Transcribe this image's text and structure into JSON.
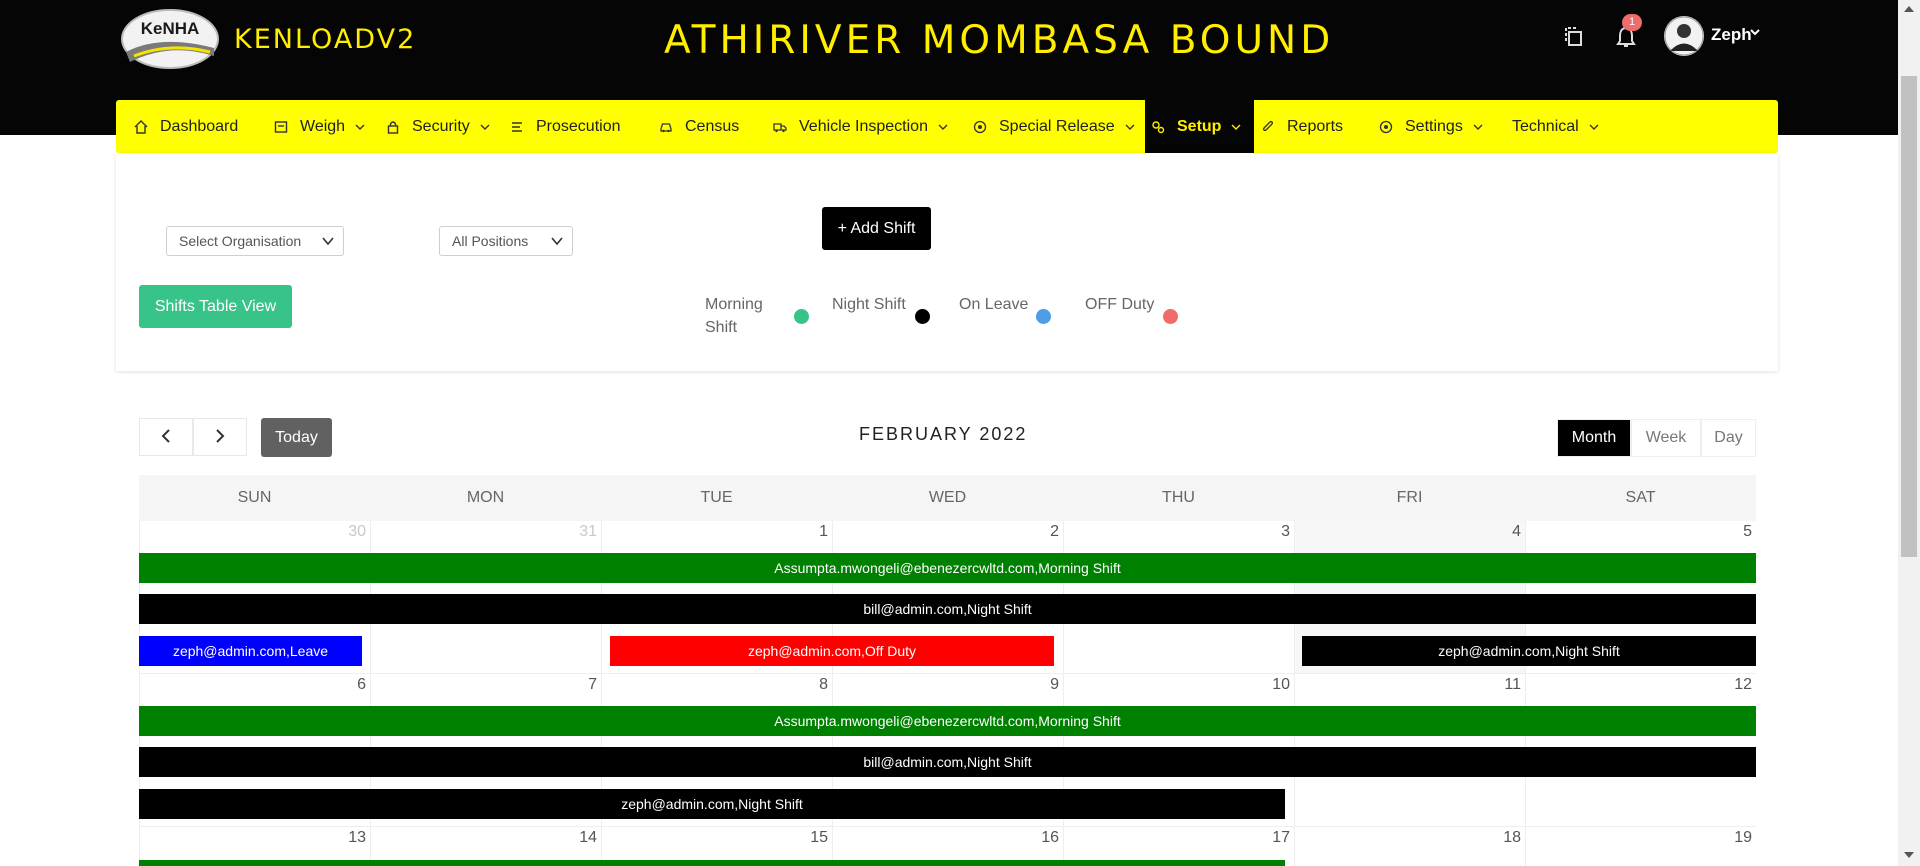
{
  "header": {
    "logo_text": "KeNHA",
    "brand": "KENLOADV2",
    "page_heading": "ATHIRIVER MOMBASA BOUND",
    "notification_count": "1",
    "user_name": "Zeph"
  },
  "nav": {
    "items": [
      {
        "label": "Dashboard",
        "icon": "home-icon"
      },
      {
        "label": "Weigh",
        "icon": "scale-icon"
      },
      {
        "label": "Security",
        "icon": "lock-icon"
      },
      {
        "label": "Prosecution",
        "icon": "list-icon"
      },
      {
        "label": "Census",
        "icon": "car-icon"
      },
      {
        "label": "Vehicle Inspection",
        "icon": "truck-icon"
      },
      {
        "label": "Special Release",
        "icon": "target-icon"
      },
      {
        "label": "Setup",
        "icon": "cogs-icon",
        "active": true
      },
      {
        "label": "Reports",
        "icon": "paperclip-icon"
      },
      {
        "label": "Settings",
        "icon": "target-icon"
      },
      {
        "label": "Technical",
        "icon": ""
      }
    ]
  },
  "filters": {
    "organisation": "Select Organisation",
    "positions": "All Positions",
    "add_shift": "+ Add Shift",
    "table_view": "Shifts Table View"
  },
  "legend": {
    "morning_line1": "Morning",
    "morning_line2": "Shift",
    "night": "Night Shift",
    "leave": "On Leave",
    "off": "OFF Duty",
    "colors": {
      "morning": "#38c389",
      "night": "#000000",
      "leave": "#4d9de8",
      "off": "#ef6c6c"
    }
  },
  "calendar": {
    "title": "FEBRUARY 2022",
    "today_label": "Today",
    "views": [
      "Month",
      "Week",
      "Day"
    ],
    "days_of_week": [
      "SUN",
      "MON",
      "TUE",
      "WED",
      "THU",
      "FRI",
      "SAT"
    ],
    "weeks": [
      {
        "dates": [
          "30",
          "31",
          "1",
          "2",
          "3",
          "4",
          "5"
        ],
        "events": [
          {
            "text": "Assumpta.mwongeli@ebenezercwltd.com,Morning Shift",
            "color": "green"
          },
          {
            "text": "bill@admin.com,Night Shift",
            "color": "black"
          },
          {
            "text": "zeph@admin.com,Leave",
            "color": "blue"
          },
          {
            "text": "zeph@admin.com,Off Duty",
            "color": "red"
          },
          {
            "text": "zeph@admin.com,Night Shift",
            "color": "black"
          }
        ]
      },
      {
        "dates": [
          "6",
          "7",
          "8",
          "9",
          "10",
          "11",
          "12"
        ],
        "events": [
          {
            "text": "Assumpta.mwongeli@ebenezercwltd.com,Morning Shift",
            "color": "green"
          },
          {
            "text": "bill@admin.com,Night Shift",
            "color": "black"
          },
          {
            "text": "zeph@admin.com,Night Shift",
            "color": "black"
          }
        ]
      },
      {
        "dates": [
          "13",
          "14",
          "15",
          "16",
          "17",
          "18",
          "19"
        ],
        "events": []
      }
    ]
  }
}
